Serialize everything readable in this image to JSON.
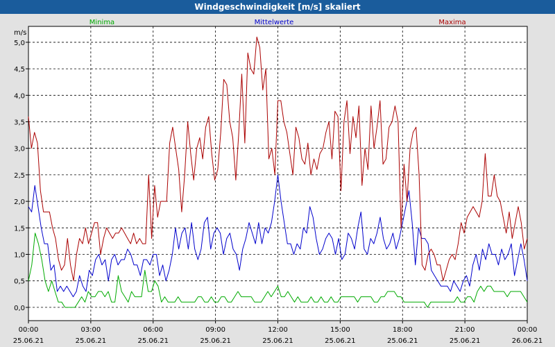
{
  "title": "Windgeschwindigkeit [m/s] skaliert",
  "chart_data": {
    "type": "line",
    "title": "Windgeschwindigkeit [m/s] skaliert",
    "ylabel": "m/s",
    "xlabel": "",
    "ylim": [
      -0.25,
      5.3
    ],
    "yticks": [
      0.0,
      0.5,
      1.0,
      1.5,
      2.0,
      2.5,
      3.0,
      3.5,
      4.0,
      4.5,
      5.0
    ],
    "ytick_labels": [
      "0,0",
      "0,5",
      "1,0",
      "1,5",
      "2,0",
      "2,5",
      "3,0",
      "3,5",
      "4,0",
      "4,5",
      "5,0"
    ],
    "xlim_hours": [
      0,
      24
    ],
    "xticks": [
      {
        "time": "00:00",
        "date": "25.06.21"
      },
      {
        "time": "03:00",
        "date": "25.06.21"
      },
      {
        "time": "06:00",
        "date": "25.06.21"
      },
      {
        "time": "09:00",
        "date": "25.06.21"
      },
      {
        "time": "12:00",
        "date": "25.06.21"
      },
      {
        "time": "15:00",
        "date": "25.06.21"
      },
      {
        "time": "18:00",
        "date": "25.06.21"
      },
      {
        "time": "21:00",
        "date": "25.06.21"
      },
      {
        "time": "00:00",
        "date": "26.06.21"
      }
    ],
    "grid": true,
    "legend_position": "top",
    "series": [
      {
        "name": "Minima",
        "color": "#00aa00",
        "values": [
          0.5,
          0.8,
          1.4,
          1.2,
          0.9,
          0.5,
          0.3,
          0.5,
          0.3,
          0.1,
          0.1,
          0.0,
          0.0,
          0.0,
          0.0,
          0.1,
          0.2,
          0.1,
          0.3,
          0.2,
          0.2,
          0.3,
          0.3,
          0.2,
          0.3,
          0.1,
          0.1,
          0.6,
          0.3,
          0.2,
          0.1,
          0.3,
          0.2,
          0.2,
          0.2,
          0.7,
          0.3,
          0.3,
          0.5,
          0.4,
          0.1,
          0.2,
          0.1,
          0.1,
          0.1,
          0.2,
          0.1,
          0.1,
          0.1,
          0.1,
          0.1,
          0.2,
          0.2,
          0.1,
          0.1,
          0.2,
          0.1,
          0.1,
          0.2,
          0.2,
          0.1,
          0.1,
          0.2,
          0.3,
          0.2,
          0.2,
          0.2,
          0.2,
          0.1,
          0.1,
          0.1,
          0.2,
          0.3,
          0.2,
          0.3,
          0.4,
          0.2,
          0.2,
          0.3,
          0.2,
          0.1,
          0.2,
          0.1,
          0.1,
          0.1,
          0.2,
          0.1,
          0.1,
          0.2,
          0.1,
          0.1,
          0.2,
          0.1,
          0.1,
          0.2,
          0.2,
          0.2,
          0.2,
          0.2,
          0.1,
          0.2,
          0.2,
          0.2,
          0.2,
          0.1,
          0.1,
          0.2,
          0.2,
          0.3,
          0.3,
          0.3,
          0.2,
          0.2,
          0.1,
          0.1,
          0.1,
          0.1,
          0.1,
          0.1,
          0.1,
          0.0,
          0.1,
          0.1,
          0.1,
          0.1,
          0.1,
          0.1,
          0.1,
          0.1,
          0.2,
          0.1,
          0.1,
          0.2,
          0.2,
          0.1,
          0.3,
          0.4,
          0.3,
          0.4,
          0.4,
          0.3,
          0.3,
          0.3,
          0.3,
          0.2,
          0.3,
          0.3,
          0.3,
          0.3,
          0.2,
          0.1
        ]
      },
      {
        "name": "Mittelwerte",
        "color": "#0000cc",
        "values": [
          1.9,
          1.8,
          2.3,
          1.9,
          1.5,
          1.2,
          1.2,
          0.7,
          0.8,
          0.3,
          0.4,
          0.3,
          0.4,
          0.3,
          0.2,
          0.3,
          0.6,
          0.4,
          0.3,
          0.7,
          0.6,
          0.9,
          1.0,
          0.8,
          0.9,
          0.5,
          0.9,
          1.0,
          0.8,
          0.9,
          0.9,
          1.1,
          1.0,
          0.8,
          0.8,
          0.6,
          0.9,
          0.9,
          0.8,
          1.0,
          1.0,
          0.6,
          0.8,
          0.5,
          0.7,
          1.0,
          1.5,
          1.1,
          1.4,
          1.5,
          1.1,
          1.6,
          1.1,
          0.9,
          1.1,
          1.6,
          1.7,
          1.1,
          1.4,
          1.5,
          1.4,
          1.0,
          1.3,
          1.4,
          1.1,
          1.0,
          0.7,
          1.1,
          1.3,
          1.6,
          1.4,
          1.2,
          1.6,
          1.2,
          1.5,
          1.4,
          1.6,
          2.0,
          2.5,
          2.0,
          1.6,
          1.2,
          1.2,
          1.0,
          1.2,
          1.1,
          1.5,
          1.4,
          1.9,
          1.7,
          1.3,
          1.0,
          1.1,
          1.3,
          1.4,
          1.3,
          1.0,
          1.3,
          0.9,
          1.0,
          1.4,
          1.3,
          1.1,
          1.5,
          1.8,
          1.1,
          1.0,
          1.3,
          1.2,
          1.4,
          1.7,
          1.3,
          1.1,
          1.2,
          1.4,
          1.1,
          1.3,
          1.6,
          1.9,
          2.2,
          1.6,
          0.8,
          1.5,
          1.3,
          1.3,
          1.2,
          0.7,
          0.6,
          0.5,
          0.4,
          0.4,
          0.4,
          0.3,
          0.5,
          0.4,
          0.3,
          0.5,
          0.6,
          0.4,
          0.8,
          1.0,
          0.7,
          1.1,
          0.9,
          1.2,
          1.0,
          1.0,
          0.8,
          1.1,
          0.9,
          1.0,
          1.2,
          0.6,
          0.9,
          1.2,
          0.9,
          0.5
        ]
      },
      {
        "name": "Maxima",
        "color": "#aa0000",
        "values": [
          3.6,
          3.0,
          3.3,
          3.1,
          2.2,
          1.8,
          1.8,
          1.8,
          1.5,
          1.3,
          0.9,
          0.7,
          0.8,
          1.3,
          0.8,
          0.5,
          1.0,
          1.3,
          1.2,
          1.5,
          1.2,
          1.4,
          1.6,
          1.6,
          1.0,
          1.3,
          1.5,
          1.4,
          1.3,
          1.4,
          1.4,
          1.5,
          1.4,
          1.3,
          1.2,
          1.4,
          1.2,
          1.3,
          1.2,
          1.2,
          2.5,
          1.3,
          2.3,
          1.7,
          2.0,
          2.0,
          2.0,
          3.1,
          3.4,
          3.0,
          2.6,
          1.8,
          2.5,
          3.5,
          2.9,
          2.4,
          3.0,
          3.2,
          2.8,
          3.4,
          3.6,
          2.9,
          2.4,
          2.6,
          3.3,
          4.3,
          4.2,
          3.5,
          3.2,
          2.4,
          3.3,
          4.4,
          3.1,
          4.8,
          4.5,
          4.4,
          5.1,
          4.9,
          4.1,
          4.5,
          2.8,
          3.0,
          2.5,
          3.9,
          3.9,
          3.5,
          3.3,
          2.9,
          2.5,
          3.4,
          3.2,
          2.8,
          2.7,
          3.1,
          2.5,
          2.8,
          2.6,
          2.9,
          3.0,
          3.3,
          3.5,
          2.8,
          3.7,
          3.6,
          2.2,
          3.5,
          3.9,
          2.9,
          3.6,
          3.2,
          3.8,
          2.3,
          3.0,
          2.6,
          3.8,
          3.0,
          3.4,
          3.9,
          2.7,
          2.8,
          3.4,
          3.5,
          3.8,
          3.5,
          1.5,
          2.7,
          2.0,
          3.0,
          3.3,
          3.4,
          2.5,
          0.8,
          0.7,
          1.0,
          1.1,
          1.0,
          0.8,
          0.8,
          0.5,
          0.7,
          0.9,
          1.0,
          0.9,
          1.2,
          1.6,
          1.4,
          1.7,
          1.8,
          1.9,
          1.8,
          1.7,
          2.0,
          2.9,
          2.1,
          2.1,
          2.5,
          2.1,
          2.0,
          1.7,
          1.4,
          1.8,
          1.3,
          1.6,
          1.9,
          1.6,
          1.1,
          1.3
        ]
      }
    ]
  }
}
